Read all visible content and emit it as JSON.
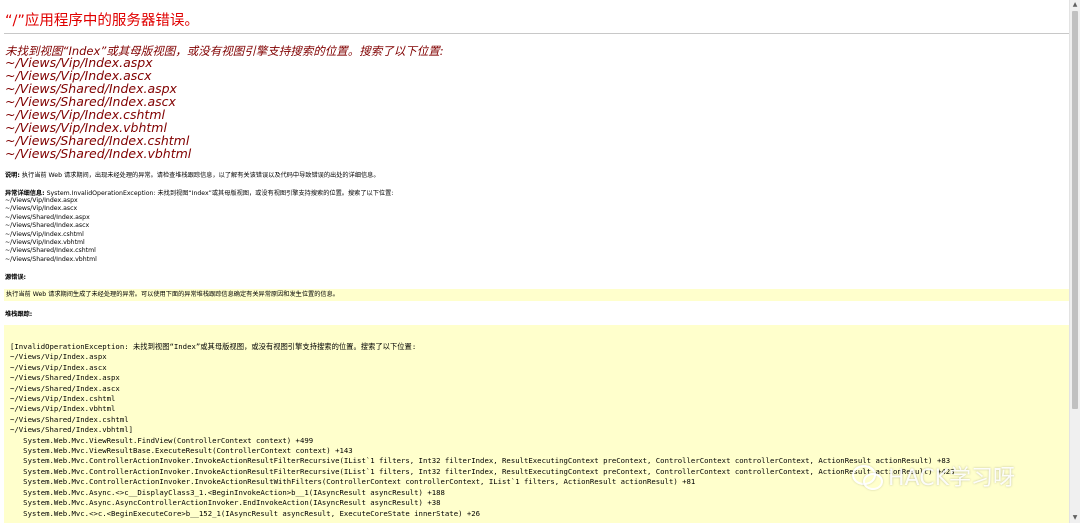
{
  "page": {
    "title": "“/”应用程序中的服务器错误。",
    "error_heading": "未找到视图“Index”或其母版视图，或没有视图引擎支持搜索的位置。搜索了以下位置:",
    "searched_paths": [
      "~/Views/Vip/Index.aspx",
      "~/Views/Vip/Index.ascx",
      "~/Views/Shared/Index.aspx",
      "~/Views/Shared/Index.ascx",
      "~/Views/Vip/Index.cshtml",
      "~/Views/Vip/Index.vbhtml",
      "~/Views/Shared/Index.cshtml",
      "~/Views/Shared/Index.vbhtml"
    ],
    "description_label": "说明:",
    "description_text": " 执行当前 Web 请求期间，出现未经处理的异常。请检查堆栈跟踪信息，以了解有关该错误以及代码中导致错误的出处的详细信息。",
    "exception_label": "异常详细信息:",
    "exception_text": " System.InvalidOperationException: 未找到视图“Index”或其母版视图，或没有视图引擎支持搜索的位置。搜索了以下位置:",
    "exception_paths": [
      "~/Views/Vip/Index.aspx",
      "~/Views/Vip/Index.ascx",
      "~/Views/Shared/Index.aspx",
      "~/Views/Shared/Index.ascx",
      "~/Views/Vip/Index.cshtml",
      "~/Views/Vip/Index.vbhtml",
      "~/Views/Shared/Index.cshtml",
      "~/Views/Shared/Index.vbhtml"
    ],
    "source_error_label": "源错误:",
    "source_error_text": "执行当前 Web 请求期间生成了未经处理的异常。可以使用下面的异常堆栈跟踪信息确定有关异常原因和发生位置的信息。",
    "stack_trace_label": "堆栈跟踪:",
    "stack_lines": [
      "[InvalidOperationException: 未找到视图“Index”或其母版视图，或没有视图引擎支持搜索的位置。搜索了以下位置:",
      "~/Views/Vip/Index.aspx",
      "~/Views/Vip/Index.ascx",
      "~/Views/Shared/Index.aspx",
      "~/Views/Shared/Index.ascx",
      "~/Views/Vip/Index.cshtml",
      "~/Views/Vip/Index.vbhtml",
      "~/Views/Shared/Index.cshtml",
      "~/Views/Shared/Index.vbhtml]",
      "   System.Web.Mvc.ViewResult.FindView(ControllerContext context) +499",
      "   System.Web.Mvc.ViewResultBase.ExecuteResult(ControllerContext context) +143",
      "   System.Web.Mvc.ControllerActionInvoker.InvokeActionResultFilterRecursive(IList`1 filters, Int32 filterIndex, ResultExecutingContext preContext, ControllerContext controllerContext, ActionResult actionResult) +83",
      "   System.Web.Mvc.ControllerActionInvoker.InvokeActionResultFilterRecursive(IList`1 filters, Int32 filterIndex, ResultExecutingContext preContext, ControllerContext controllerContext, ActionResult actionResult) +423",
      "   System.Web.Mvc.ControllerActionInvoker.InvokeActionResultWithFilters(ControllerContext controllerContext, IList`1 filters, ActionResult actionResult) +81",
      "   System.Web.Mvc.Async.<>c__DisplayClass3_1.<BeginInvokeAction>b__1(IAsyncResult asyncResult) +188",
      "   System.Web.Mvc.Async.AsyncControllerActionInvoker.EndInvokeAction(IAsyncResult asyncResult) +38",
      "   System.Web.Mvc.<>c.<BeginExecuteCore>b__152_1(IAsyncResult asyncResult, ExecuteCoreState innerState) +26"
    ]
  },
  "watermark": {
    "text": "HACK学习呀",
    "icon": "wechat-icon"
  },
  "colors": {
    "title": "#e00000",
    "heading": "#800000",
    "highlight_bg": "#ffffcc"
  }
}
